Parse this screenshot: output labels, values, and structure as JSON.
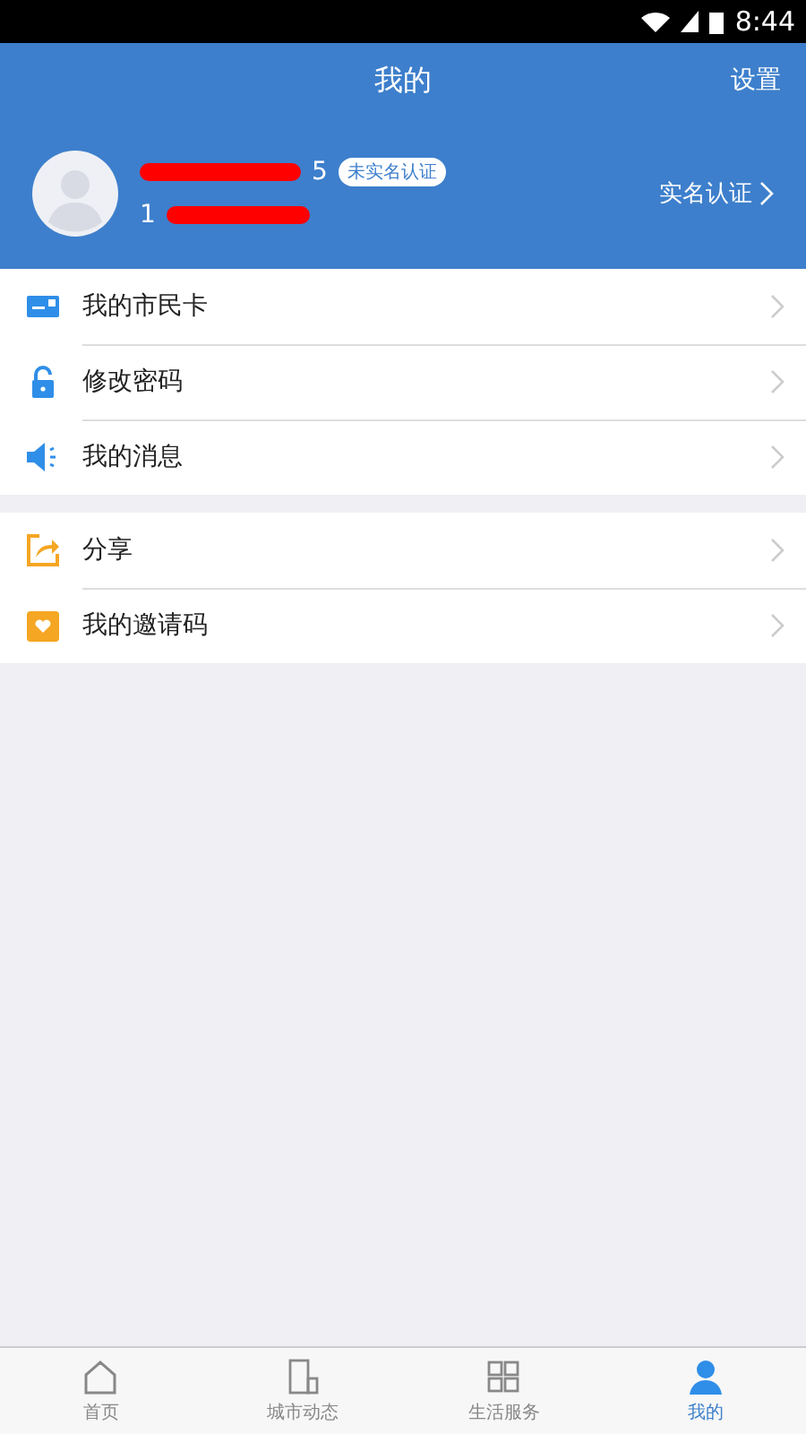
{
  "status_bar": {
    "time": "8:44"
  },
  "header": {
    "title": "我的",
    "action": "设置"
  },
  "profile": {
    "name_visible": "5",
    "badge": "未实名认证",
    "phone_visible": "1",
    "verify_link": "实名认证"
  },
  "menu_groups": [
    [
      {
        "kind": "card",
        "label": "我的市民卡"
      },
      {
        "kind": "lock",
        "label": "修改密码"
      },
      {
        "kind": "speaker",
        "label": "我的消息"
      }
    ],
    [
      {
        "kind": "share",
        "label": "分享"
      },
      {
        "kind": "invite",
        "label": "我的邀请码"
      }
    ]
  ],
  "tabs": [
    {
      "kind": "home",
      "label": "首页",
      "selected": false
    },
    {
      "kind": "building",
      "label": "城市动态",
      "selected": false
    },
    {
      "kind": "service",
      "label": "生活服务",
      "selected": false
    },
    {
      "kind": "person",
      "label": "我的",
      "selected": true
    }
  ]
}
